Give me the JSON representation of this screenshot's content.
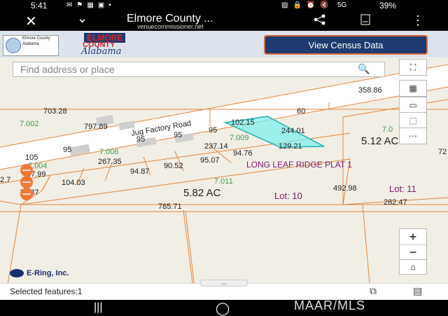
{
  "status_bar": {
    "time": "5:41",
    "network": "5G",
    "battery": "39%"
  },
  "app_bar": {
    "title": "Elmore County ...",
    "url": "venuecommissioner.net"
  },
  "banner": {
    "logo_line1": "Elmore County",
    "logo_line2": "Alabama",
    "brand_line1": "ELMORE",
    "brand_line2": "COUNTY",
    "brand_line3": "Alabama",
    "census_button": "View Census Data"
  },
  "search": {
    "placeholder": "Find address or place"
  },
  "map": {
    "road_label": "Jug Factory Road",
    "subdivision_label": "LONG LEAF RIDGE PLAT 1",
    "acreage": [
      "5.12 AC",
      "5.82 AC"
    ],
    "lot_labels": [
      "Lot: 10",
      "Lot: 11"
    ],
    "dimensions": [
      "703.28",
      "797.89",
      "358.86",
      "60",
      "102.15",
      "244.01",
      "129.21",
      "95",
      "95",
      "95",
      "95",
      "237.14",
      "94.76",
      "267.35",
      "94.87",
      "90.52",
      "95.07",
      "105",
      "57.99",
      "104.03",
      "15.87",
      "492.98",
      "282.47",
      "785.71"
    ],
    "parcel_ids": [
      "7.002",
      "7.006",
      "7.004",
      "7.009",
      "7.011",
      "7.0"
    ],
    "edge_labels": [
      "72",
      "2.7"
    ]
  },
  "footer": {
    "selected": "Selected features:1",
    "vendor": "E-Ring, Inc."
  },
  "watermark": "MAAR/MLS"
}
